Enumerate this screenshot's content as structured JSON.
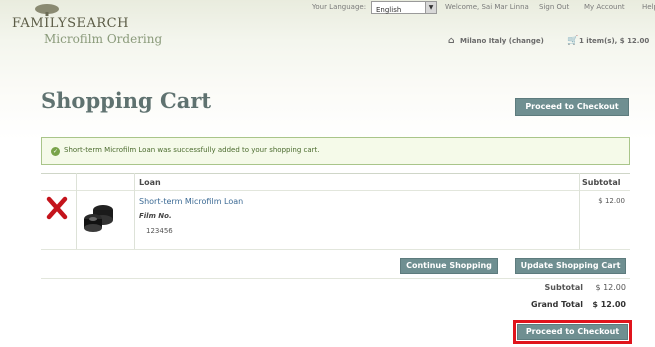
{
  "brand": {
    "name": "FAMILYSEARCH",
    "subtitle": "Microfilm Ordering"
  },
  "topbar": {
    "language_label": "Your Language:",
    "language_value": "English",
    "welcome": "Welcome, Sai Mar Linna",
    "sign_out": "Sign Out",
    "my_account": "My Account",
    "help": "Help"
  },
  "location": {
    "text": "Milano Italy (change)",
    "cart_summary": "1 item(s), $ 12.00"
  },
  "page": {
    "title": "Shopping Cart"
  },
  "buttons": {
    "checkout_top": "Proceed to Checkout",
    "continue": "Continue Shopping",
    "update": "Update Shopping Cart",
    "checkout_bottom": "Proceed to Checkout"
  },
  "message": {
    "success": "Short-term Microfilm Loan was successfully added to your shopping cart."
  },
  "table": {
    "headers": {
      "item": "Loan",
      "subtotal": "Subtotal"
    },
    "rows": [
      {
        "name": "Short-term Microfilm Loan",
        "film_label": "Film No.",
        "film_no": "123456",
        "price": "$ 12.00"
      }
    ]
  },
  "totals": {
    "subtotal_label": "Subtotal",
    "subtotal": "$ 12.00",
    "grand_label": "Grand Total",
    "grand": "$ 12.00"
  },
  "colors": {
    "button": "#6f8f91",
    "highlight": "#e0141c",
    "success_border": "#a9c58a",
    "title": "#5f7270",
    "link": "#3d6b95"
  },
  "icons": [
    "tree-logo-icon",
    "home-icon",
    "cart-icon",
    "check-icon",
    "remove-x-icon",
    "film-reel-icon"
  ]
}
